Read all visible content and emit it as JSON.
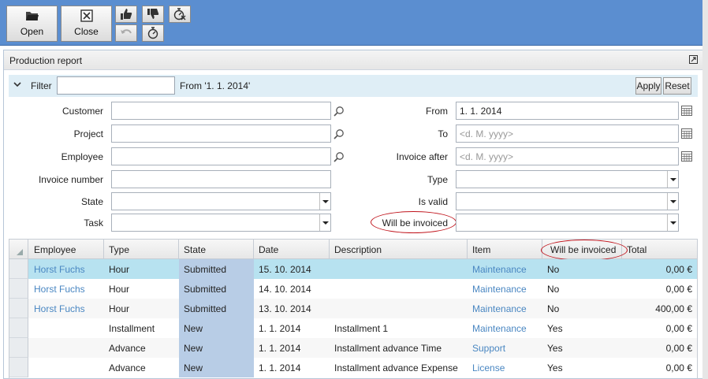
{
  "toolbar": {
    "open_label": "Open",
    "close_label": "Close"
  },
  "panel": {
    "title": "Production report"
  },
  "filter": {
    "label": "Filter",
    "input_value": "",
    "summary": "From '1. 1. 2014'",
    "apply_label": "Apply",
    "reset_label": "Reset"
  },
  "form": {
    "customer": {
      "label": "Customer",
      "value": ""
    },
    "project": {
      "label": "Project",
      "value": ""
    },
    "employee": {
      "label": "Employee",
      "value": ""
    },
    "invoice_number": {
      "label": "Invoice number",
      "value": ""
    },
    "state": {
      "label": "State",
      "value": ""
    },
    "task": {
      "label": "Task",
      "value": ""
    },
    "from": {
      "label": "From",
      "value": "1. 1. 2014"
    },
    "to": {
      "label": "To",
      "placeholder": "<d. M. yyyy>"
    },
    "invoice_after": {
      "label": "Invoice after",
      "placeholder": "<d. M. yyyy>"
    },
    "type": {
      "label": "Type",
      "value": ""
    },
    "is_valid": {
      "label": "Is valid",
      "value": ""
    },
    "will_be_invoiced": {
      "label": "Will be invoiced",
      "value": ""
    }
  },
  "grid": {
    "columns": [
      "Employee",
      "Type",
      "State",
      "Date",
      "Description",
      "Item",
      "Will be invoiced",
      "Total"
    ],
    "rows": [
      {
        "employee": "Horst Fuchs",
        "type": "Hour",
        "state": "Submitted",
        "date": "15. 10. 2014",
        "description": "",
        "item": "Maintenance",
        "invoiced": "No",
        "total": "0,00 €"
      },
      {
        "employee": "Horst Fuchs",
        "type": "Hour",
        "state": "Submitted",
        "date": "14. 10. 2014",
        "description": "",
        "item": "Maintenance",
        "invoiced": "No",
        "total": "0,00 €"
      },
      {
        "employee": "Horst Fuchs",
        "type": "Hour",
        "state": "Submitted",
        "date": "13. 10. 2014",
        "description": "",
        "item": "Maintenance",
        "invoiced": "No",
        "total": "400,00 €"
      },
      {
        "employee": "",
        "type": "Installment",
        "state": "New",
        "date": "1. 1. 2014",
        "description": "Installment 1",
        "item": "Maintenance",
        "invoiced": "Yes",
        "total": "0,00 €"
      },
      {
        "employee": "",
        "type": "Advance",
        "state": "New",
        "date": "1. 1. 2014",
        "description": "Installment advance Time",
        "item": "Support",
        "invoiced": "Yes",
        "total": "0,00 €"
      },
      {
        "employee": "",
        "type": "Advance",
        "state": "New",
        "date": "1. 1. 2014",
        "description": "Installment advance Expense",
        "item": "License",
        "invoiced": "Yes",
        "total": "0,00 €"
      }
    ]
  },
  "colors": {
    "toolbar_bg": "#5b8ed0",
    "selected_row": "#b7e2f0",
    "state_column": "#b8cde6",
    "link": "#4a87c2",
    "annotation": "#c0141c"
  }
}
